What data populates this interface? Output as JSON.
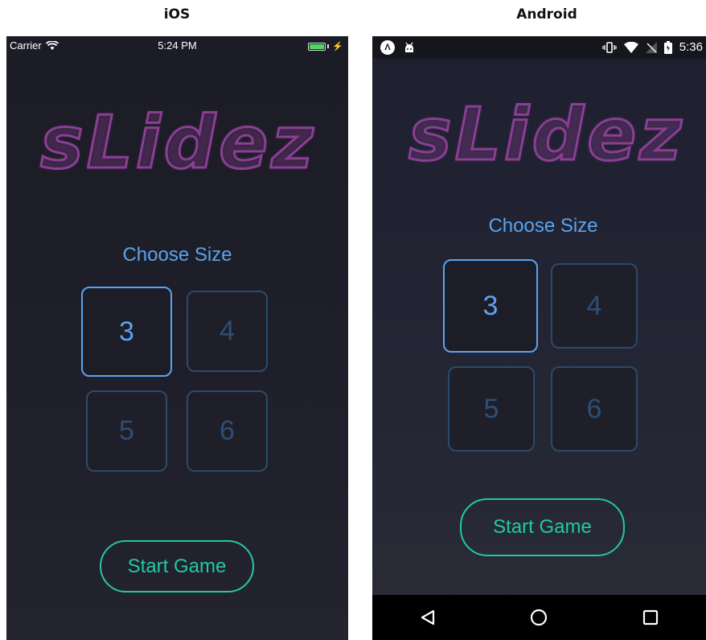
{
  "labels": {
    "ios": "iOS",
    "android": "Android"
  },
  "ios": {
    "status": {
      "carrier": "Carrier",
      "time": "5:24 PM",
      "battery_icon": "battery-charging-icon",
      "wifi_icon": "wifi-icon"
    },
    "logo": "sLidez",
    "choose_size": "Choose Size",
    "sizes": [
      "3",
      "4",
      "5",
      "6"
    ],
    "selected_size": "3",
    "start_button": "Start Game"
  },
  "android": {
    "status": {
      "time": "5:36",
      "left_icons": [
        "expo-icon",
        "android-debug-icon"
      ],
      "right_icons": [
        "vibrate-icon",
        "wifi-icon",
        "no-signal-icon",
        "battery-icon"
      ]
    },
    "logo": "sLidez",
    "choose_size": "Choose Size",
    "sizes": [
      "3",
      "4",
      "5",
      "6"
    ],
    "selected_size": "3",
    "start_button": "Start Game",
    "nav": {
      "back": "◁",
      "home": "○",
      "recents": "□"
    }
  },
  "colors": {
    "accent_blue": "#5aa3f0",
    "start_teal": "#22c9a3",
    "logo_purple": "#8a3f93",
    "tile_border": "#2b4a6b"
  }
}
